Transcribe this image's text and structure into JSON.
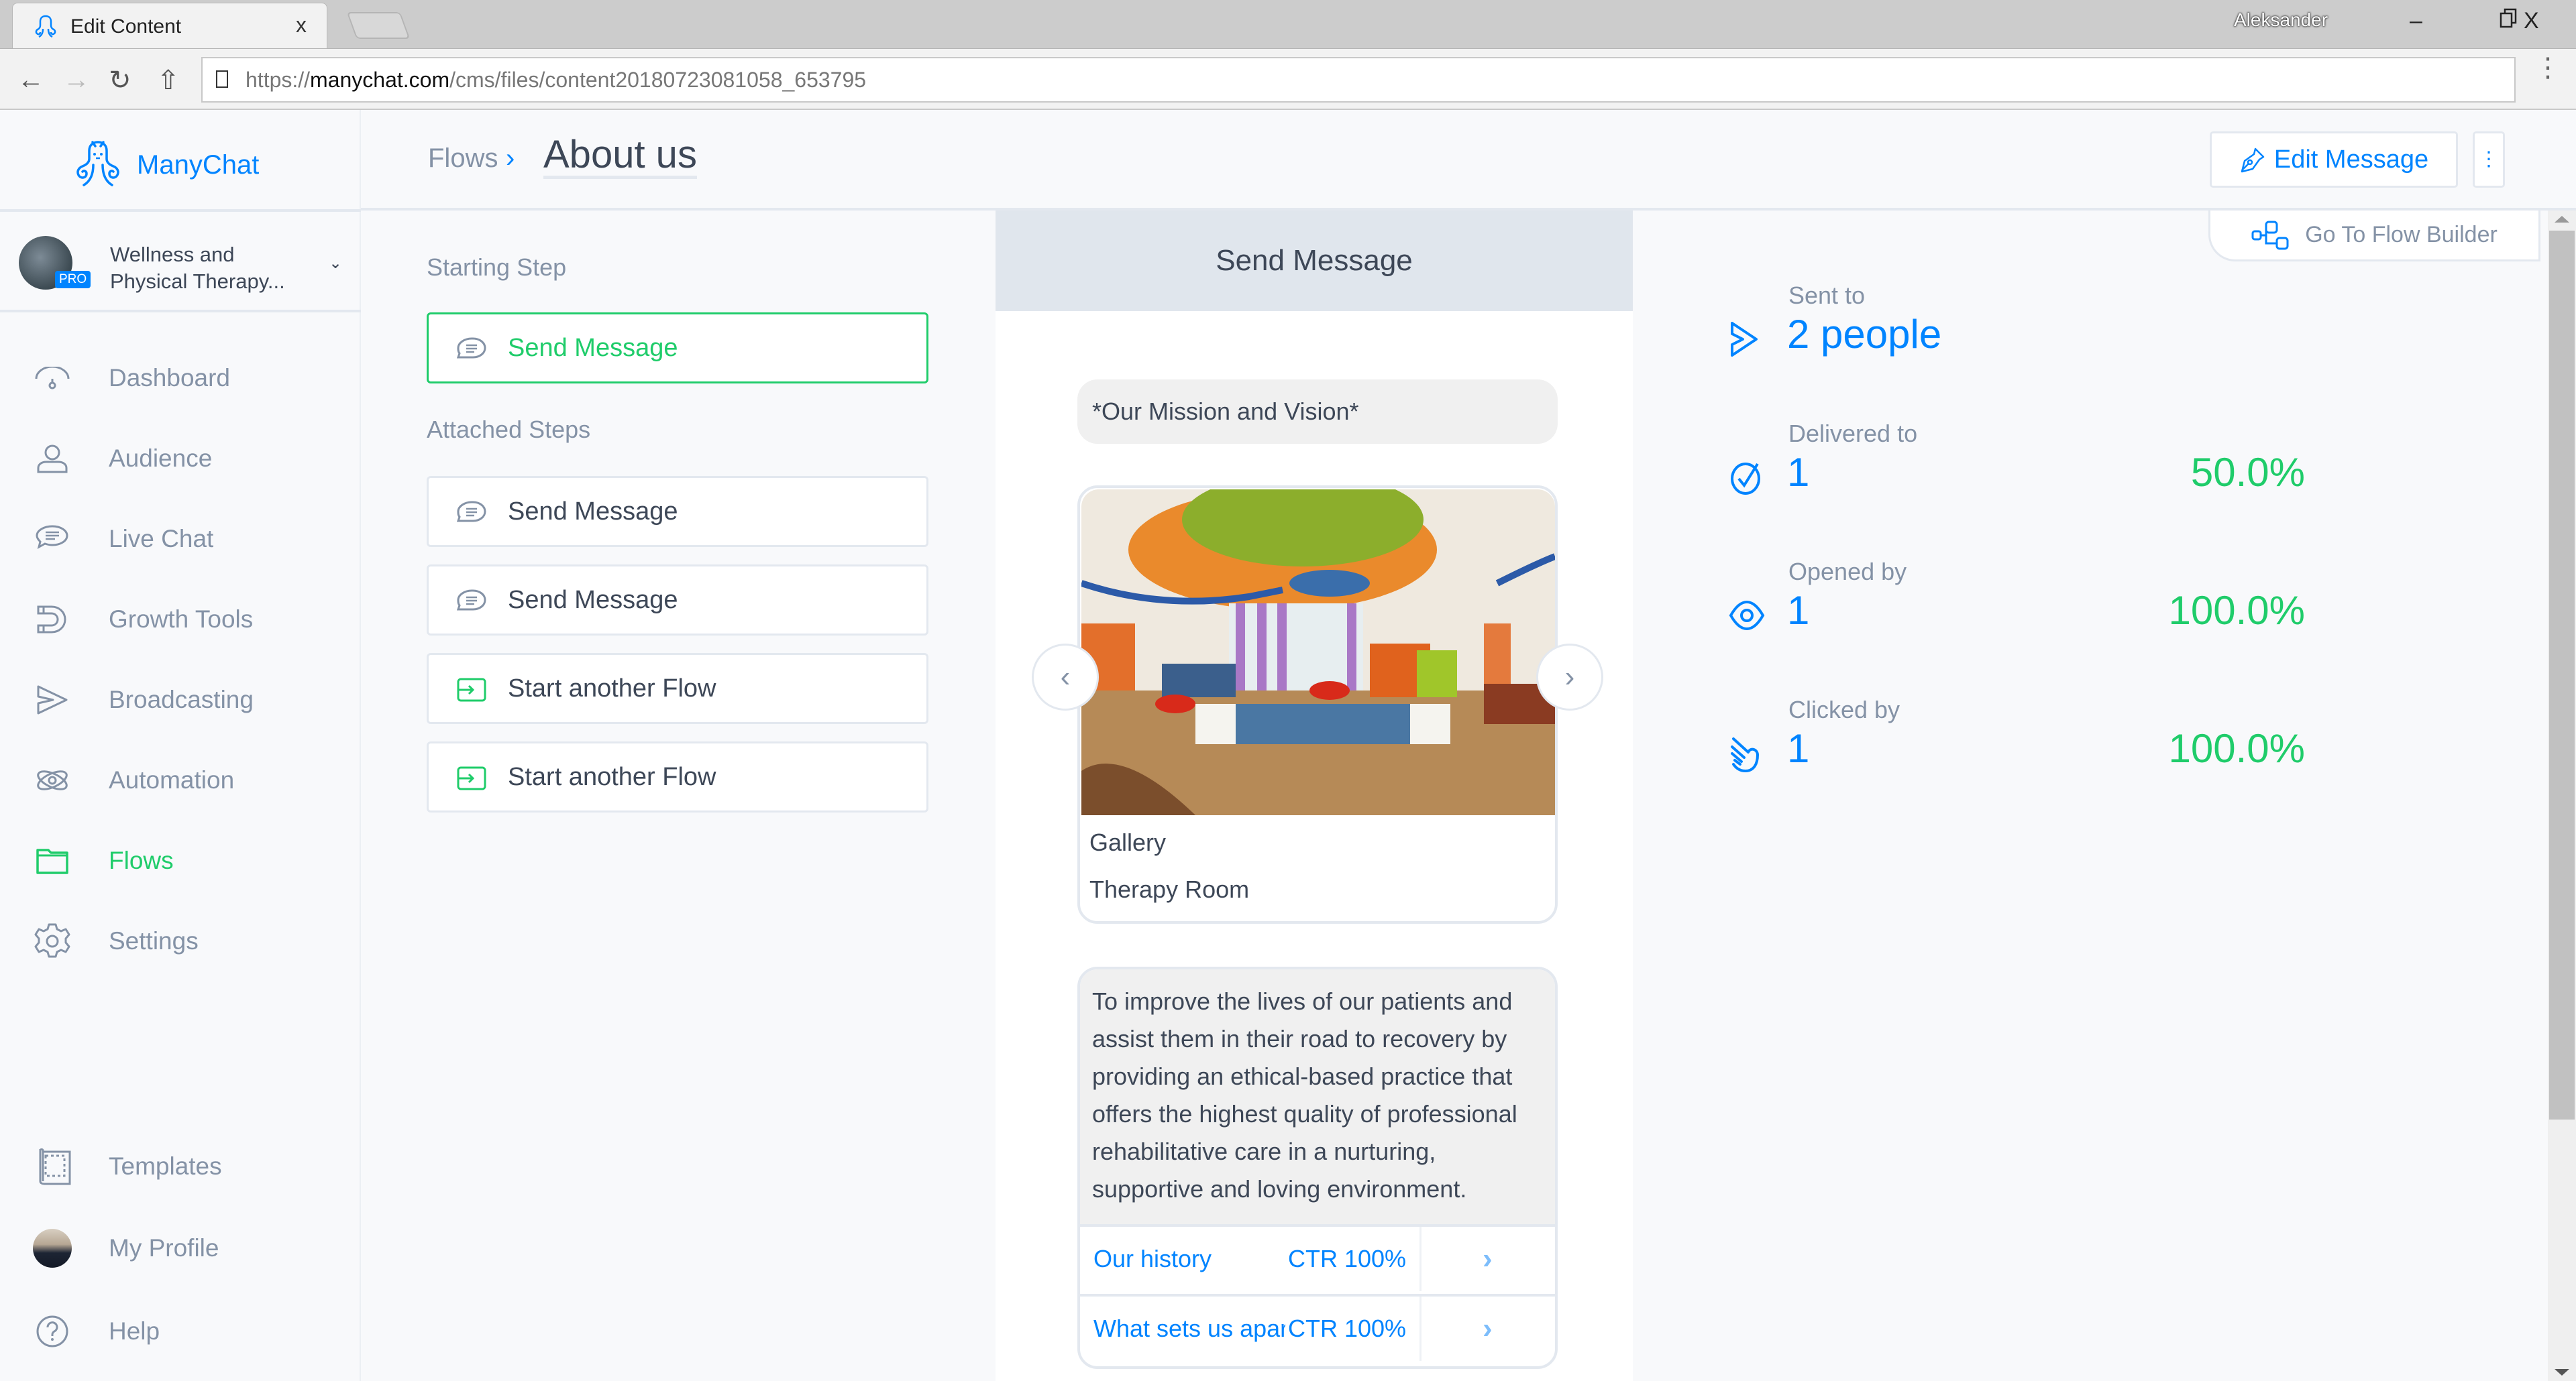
{
  "browser": {
    "tab_title": "Edit Content",
    "tab_close": "x",
    "url_scheme": "https://",
    "url_host": "manychat.com",
    "url_path": "/cms/files/content20180723081058_653795",
    "window_user": "Aleksander",
    "minimize": "–",
    "restore": "❐",
    "close": "X"
  },
  "sidebar": {
    "brand": "ManyChat",
    "account": {
      "name_line1": "Wellness and",
      "name_line2": "Physical Therapy...",
      "badge": "PRO"
    },
    "nav": [
      {
        "label": "Dashboard",
        "icon": "dashboard-gauge-icon"
      },
      {
        "label": "Audience",
        "icon": "person-icon"
      },
      {
        "label": "Live Chat",
        "icon": "chat-bubble-icon"
      },
      {
        "label": "Growth Tools",
        "icon": "magnet-icon"
      },
      {
        "label": "Broadcasting",
        "icon": "send-icon"
      },
      {
        "label": "Automation",
        "icon": "atom-icon"
      },
      {
        "label": "Flows",
        "icon": "folder-icon",
        "active": true
      },
      {
        "label": "Settings",
        "icon": "gear-icon"
      }
    ],
    "bottom_nav": [
      {
        "label": "Templates",
        "icon": "template-scroll-icon"
      },
      {
        "label": "My Profile",
        "icon": "profile-avatar"
      },
      {
        "label": "Help",
        "icon": "help-circle-icon"
      }
    ]
  },
  "header": {
    "breadcrumb_parent": "Flows",
    "breadcrumb_sep": "›",
    "title": "About us",
    "edit_button": "Edit Message",
    "more_button": "⋮",
    "flow_builder_button": "Go To Flow Builder"
  },
  "steps": {
    "starting_label": "Starting Step",
    "starting": [
      {
        "label": "Send Message",
        "type": "message"
      }
    ],
    "attached_label": "Attached Steps",
    "attached": [
      {
        "label": "Send Message",
        "type": "message"
      },
      {
        "label": "Send Message",
        "type": "message"
      },
      {
        "label": "Start another Flow",
        "type": "flow"
      },
      {
        "label": "Start another Flow",
        "type": "flow"
      }
    ]
  },
  "preview": {
    "title": "Send Message",
    "text_bubble": "*Our Mission and Vision*",
    "gallery_card": {
      "title": "Gallery",
      "subtitle": "Therapy Room",
      "prev": "‹",
      "next": "›"
    },
    "text_card": {
      "body": "To improve the lives of our patients and assist them in their road to recovery by providing an ethical-based practice that offers the highest quality of professional rehabilitative care in a nurturing, supportive and loving environment.",
      "buttons": [
        {
          "label": "Our history",
          "ctr": "CTR 100%",
          "chevron": "›"
        },
        {
          "label": "What sets us apart",
          "ctr": "CTR 100%",
          "chevron": "›"
        }
      ]
    }
  },
  "stats": [
    {
      "label": "Sent to",
      "value": "2 people",
      "percent": "",
      "icon": "send-icon"
    },
    {
      "label": "Delivered to",
      "value": "1",
      "percent": "50.0%",
      "icon": "check-circle-icon"
    },
    {
      "label": "Opened by",
      "value": "1",
      "percent": "100.0%",
      "icon": "eye-icon"
    },
    {
      "label": "Clicked by",
      "value": "1",
      "percent": "100.0%",
      "icon": "hand-click-icon"
    }
  ],
  "colors": {
    "brand_blue": "#0084ff",
    "success_green": "#1fcc6a",
    "muted_text": "#8492a6",
    "body_text": "#3d4757"
  }
}
